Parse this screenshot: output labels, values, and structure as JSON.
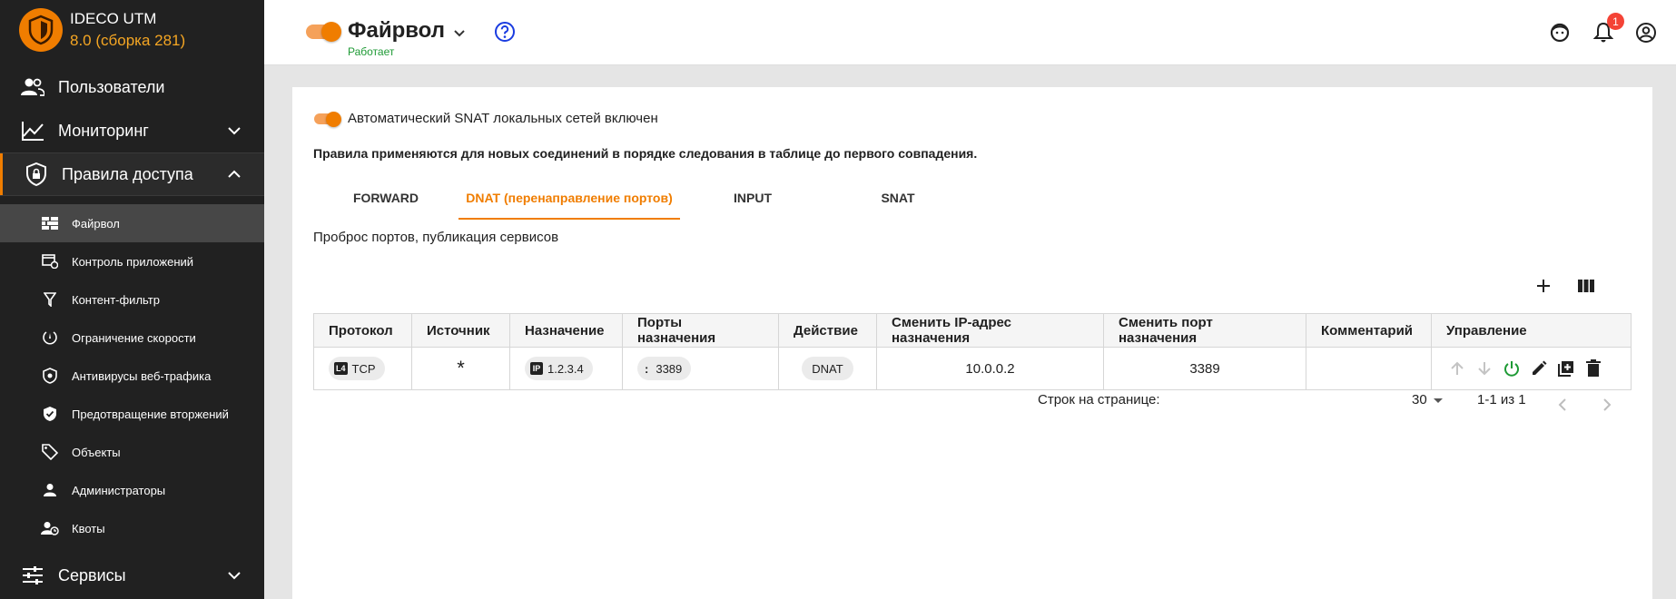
{
  "brand": {
    "name": "IDECO UTM",
    "version": "8.0 (сборка 281)",
    "accent": "#f07d00"
  },
  "sidebar": {
    "users": "Пользователи",
    "monitoring": "Мониторинг",
    "access_rules": "Правила доступа",
    "sub_items": [
      {
        "label": "Файрвол",
        "icon": "firewall-icon"
      },
      {
        "label": "Контроль приложений",
        "icon": "app-control-icon"
      },
      {
        "label": "Контент-фильтр",
        "icon": "filter-icon"
      },
      {
        "label": "Ограничение скорости",
        "icon": "speed-limit-icon"
      },
      {
        "label": "Антивирусы веб-трафика",
        "icon": "antivirus-icon"
      },
      {
        "label": "Предотвращение вторжений",
        "icon": "ips-icon"
      },
      {
        "label": "Объекты",
        "icon": "tag-icon"
      },
      {
        "label": "Администраторы",
        "icon": "admin-icon"
      },
      {
        "label": "Квоты",
        "icon": "quota-icon"
      }
    ],
    "services": "Сервисы"
  },
  "header": {
    "title": "Файрвол",
    "status": "Работает",
    "notifications_count": "1",
    "status_color": "#1e9a35"
  },
  "card": {
    "snat_label": "Автоматический SNAT локальных сетей включен",
    "rule_note": "Правила применяются для новых соединений в порядке следования в таблице до первого совпадения.",
    "tabs": [
      "FORWARD",
      "DNAT (перенаправление портов)",
      "INPUT",
      "SNAT"
    ],
    "active_tab": "DNAT (перенаправление портов)",
    "tab_description": "Проброс портов, публикация сервисов"
  },
  "table": {
    "columns": [
      "Протокол",
      "Источник",
      "Назначение",
      "Порты назначения",
      "Действие",
      "Сменить IP-адрес назначения",
      "Сменить порт назначения",
      "Комментарий",
      "Управление"
    ],
    "rows": [
      {
        "protocol_tag": "L4",
        "protocol": "TCP",
        "source": "*",
        "destination_tag": "IP",
        "destination": "1.2.3.4",
        "ports_tag": ":",
        "ports": "3389",
        "action": "DNAT",
        "change_ip": "10.0.0.2",
        "change_port": "3389",
        "comment": ""
      }
    ]
  },
  "pagination": {
    "rows_per_page_label": "Строк на странице:",
    "rows_per_page": "30",
    "range": "1-1 из 1"
  }
}
